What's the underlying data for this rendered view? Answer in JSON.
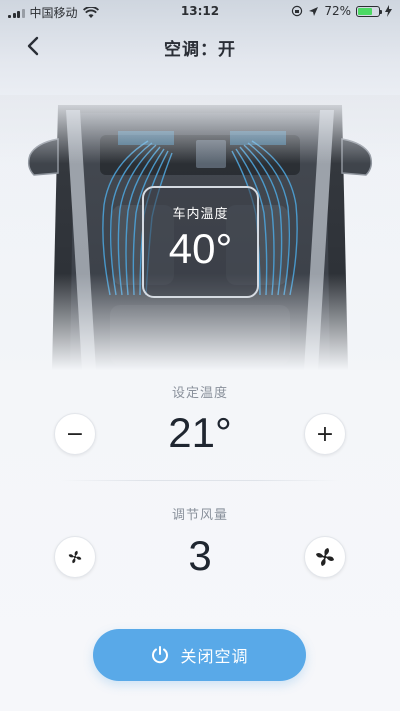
{
  "status_bar": {
    "carrier": "中国移动",
    "time": "13:12",
    "battery": "72%",
    "battery_level": 0.72
  },
  "nav": {
    "title": "空调：开"
  },
  "cabin": {
    "label": "车内温度",
    "value": "40°"
  },
  "set_temperature": {
    "label": "设定温度",
    "minus": "−",
    "plus": "+",
    "value": "21°"
  },
  "fan": {
    "label": "调节风量",
    "value": "3"
  },
  "power": {
    "label": "关闭空调"
  },
  "colors": {
    "accent": "#59a9e8",
    "airflow": "#4aa6e0"
  }
}
